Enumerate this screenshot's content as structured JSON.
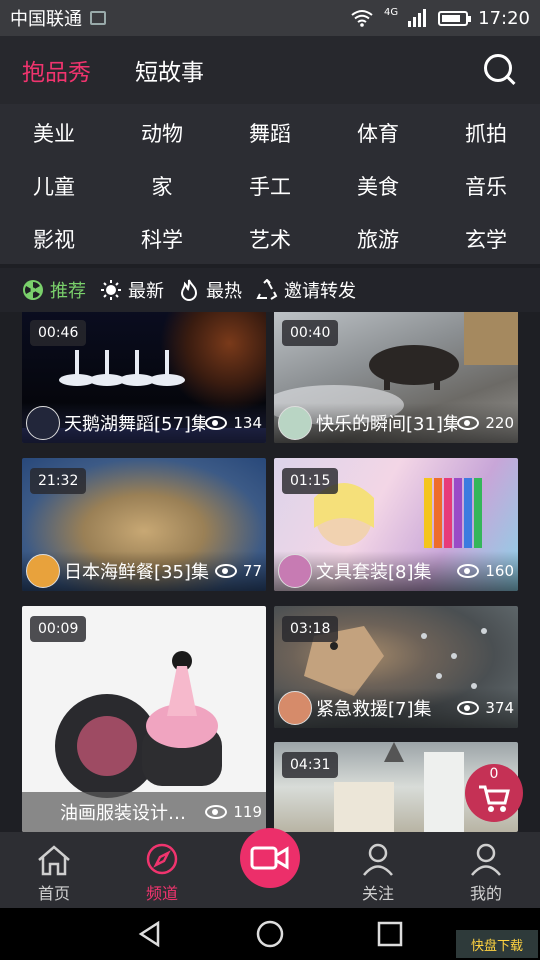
{
  "status_bar": {
    "carrier": "中国联通",
    "network": "4G",
    "time": "17:20",
    "battery_level": 0.8
  },
  "header": {
    "tabs": [
      {
        "label": "抱品秀",
        "active": true
      },
      {
        "label": "短故事",
        "active": false
      }
    ]
  },
  "categories": [
    "美业",
    "动物",
    "舞蹈",
    "体育",
    "抓拍",
    "儿童",
    "家",
    "手工",
    "美食",
    "音乐",
    "影视",
    "科学",
    "艺术",
    "旅游",
    "玄学"
  ],
  "filters": [
    {
      "label": "推荐",
      "icon": "radiation-icon",
      "active": true
    },
    {
      "label": "最新",
      "icon": "sun-icon",
      "active": false
    },
    {
      "label": "最热",
      "icon": "flame-icon",
      "active": false
    },
    {
      "label": "邀请转发",
      "icon": "recycle-icon",
      "active": false
    }
  ],
  "videos": [
    {
      "duration": "00:46",
      "title": "天鹅湖舞蹈[57]集",
      "views": "134"
    },
    {
      "duration": "00:40",
      "title": "快乐的瞬间[31]集",
      "views": "220"
    },
    {
      "duration": "21:32",
      "title": "日本海鲜餐[35]集",
      "views": "77"
    },
    {
      "duration": "01:15",
      "title": "文具套装[8]集",
      "views": "160"
    },
    {
      "duration": "00:09",
      "title": "油画服装设计…",
      "views": "119"
    },
    {
      "duration": "03:18",
      "title": "紧急救援[7]集",
      "views": "374"
    },
    {
      "duration": "04:31",
      "title": "",
      "views": ""
    }
  ],
  "cart": {
    "count": "0"
  },
  "bottom_nav": [
    {
      "label": "首页",
      "icon": "home-icon",
      "active": false
    },
    {
      "label": "频道",
      "icon": "compass-icon",
      "active": true
    },
    {
      "label": "",
      "icon": "video-camera-icon",
      "active": false
    },
    {
      "label": "关注",
      "icon": "user-icon",
      "active": false
    },
    {
      "label": "我的",
      "icon": "user-icon",
      "active": false
    }
  ],
  "watermark": {
    "text": "快盘下载"
  },
  "colors": {
    "accent": "#f0346e",
    "recommend_green": "#7ad06b",
    "background": "#1e1f24"
  }
}
